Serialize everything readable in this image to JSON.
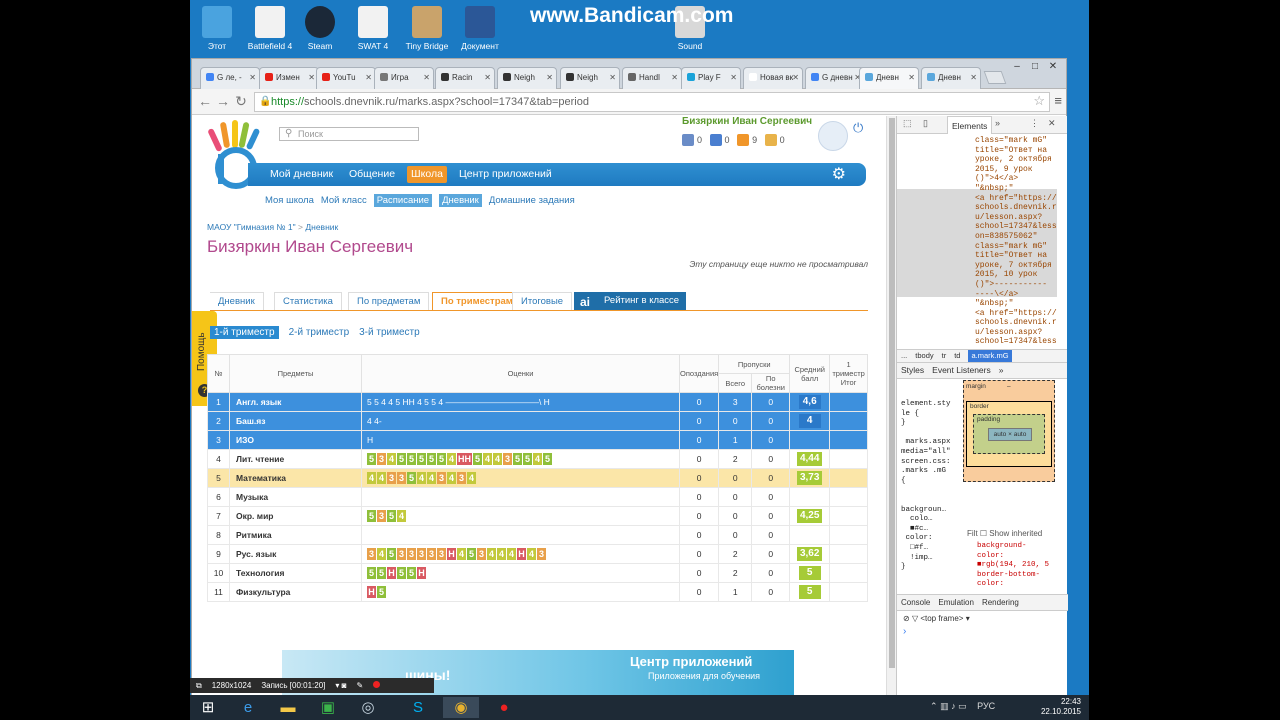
{
  "watermark": "www.Bandicam.com",
  "desktop_icons": [
    "Этот",
    "Battlefield 4",
    "Steam",
    "SWAT 4",
    "Tiny Bridge",
    "Документ",
    "Sound"
  ],
  "browser": {
    "tabs": [
      {
        "label": "G ле, -",
        "color": "#4285f4"
      },
      {
        "label": "Измен",
        "color": "#e62117"
      },
      {
        "label": "YouTu",
        "color": "#e62117"
      },
      {
        "label": "Игра",
        "color": "#777"
      },
      {
        "label": "Racin",
        "color": "#333"
      },
      {
        "label": "Neigh",
        "color": "#333"
      },
      {
        "label": "Neigh",
        "color": "#333"
      },
      {
        "label": "Handl",
        "color": "#666"
      },
      {
        "label": "Play F",
        "color": "#1aa3d9"
      },
      {
        "label": "Новая вк",
        "color": "#fff"
      },
      {
        "label": "G дневн",
        "color": "#4285f4"
      },
      {
        "label": "Дневн",
        "color": "#5aa7dc"
      },
      {
        "label": "Дневн",
        "color": "#5aa7dc"
      }
    ],
    "url_https": "https://",
    "url_rest": "schools.dnevnik.ru/marks.aspx?school=17347&tab=period"
  },
  "site": {
    "search_placeholder": "Поиск",
    "user_name": "Бизяркин Иван Сергеевич",
    "stats": [
      {
        "value": "0",
        "color": "#6a8cc7"
      },
      {
        "value": "0",
        "color": "#4a7fd0"
      },
      {
        "value": "9",
        "color": "#f0962a"
      },
      {
        "value": "0",
        "color": "#e8b34a"
      }
    ],
    "nav": [
      "Мой дневник",
      "Общение",
      "Школа",
      "Центр приложений"
    ],
    "subnav": [
      "Моя школа",
      "Мой класс",
      "Расписание",
      "Дневник",
      "Домашние задания"
    ],
    "breadcrumb_school": "МАОУ \"Гимназия № 1\"",
    "breadcrumb_sep": ">",
    "breadcrumb_page": "Дневник",
    "page_title": "Бизяркин Иван Сергеевич",
    "notice": "Эту страницу еще никто не просматривал",
    "help": "Помощь",
    "tabs": [
      "Дневник",
      "Статистика",
      "По предметам",
      "По триместрам",
      "Итоговые"
    ],
    "rating_label": "Рейтинг в классе",
    "terms": [
      "1-й триместр",
      "2-й триместр",
      "3-й триместр"
    ],
    "table_headers": {
      "num": "№",
      "subject": "Предметы",
      "marks": "Оценки",
      "late": "Опоздания",
      "absences": "Пропуски",
      "total": "Всего",
      "sick": "По болезни",
      "avg": "Средний балл",
      "final": "1 триместр Итог"
    },
    "rows": [
      {
        "n": "1",
        "subject": "Англ. язык",
        "marks": "5 5 4 4 5 НН 4 5 5 4 ———————————\\ Н",
        "late": "0",
        "total": "3",
        "sick": "0",
        "avg": "4,6",
        "state": "sel"
      },
      {
        "n": "2",
        "subject": "Баш.яз",
        "marks": "4 4-",
        "late": "0",
        "total": "0",
        "sick": "0",
        "avg": "4",
        "state": "sel"
      },
      {
        "n": "3",
        "subject": "ИЗО",
        "marks": "Н",
        "late": "0",
        "total": "1",
        "sick": "0",
        "avg": "",
        "state": "sel"
      },
      {
        "n": "4",
        "subject": "Лит. чтение",
        "marks": "5 3 4 5 5 5 5 5 4 НН 5 4 4 3 5 5 4 5",
        "late": "0",
        "total": "2",
        "sick": "0",
        "avg": "4,44",
        "state": ""
      },
      {
        "n": "5",
        "subject": "Математика",
        "marks": "4 4 3 3 5 4 4 3 4 3 4",
        "late": "0",
        "total": "0",
        "sick": "0",
        "avg": "3,73",
        "state": "hl"
      },
      {
        "n": "6",
        "subject": "Музыка",
        "marks": "",
        "late": "0",
        "total": "0",
        "sick": "0",
        "avg": "",
        "state": ""
      },
      {
        "n": "7",
        "subject": "Окр. мир",
        "marks": "5 3 5 4",
        "late": "0",
        "total": "0",
        "sick": "0",
        "avg": "4,25",
        "state": ""
      },
      {
        "n": "8",
        "subject": "Ритмика",
        "marks": "",
        "late": "0",
        "total": "0",
        "sick": "0",
        "avg": "",
        "state": ""
      },
      {
        "n": "9",
        "subject": "Рус. язык",
        "marks": "3 4 5 3 3 3 3 3 Н 4 5 3 4 4 4 Н 4 3",
        "late": "0",
        "total": "2",
        "sick": "0",
        "avg": "3,62",
        "state": ""
      },
      {
        "n": "10",
        "subject": "Технология",
        "marks": "5 5 Н 5 5 Н",
        "late": "0",
        "total": "2",
        "sick": "0",
        "avg": "5",
        "state": ""
      },
      {
        "n": "11",
        "subject": "Физкультура",
        "marks": "Н 5",
        "late": "0",
        "total": "1",
        "sick": "0",
        "avg": "5",
        "state": ""
      }
    ],
    "banner_left": "шины!",
    "banner_title": "Центр приложений",
    "banner_sub": "Приложения для обучения"
  },
  "devtools": {
    "elements_tab": "Elements",
    "dom_lines": [
      "class=\"mark mG\"",
      "title=\"Ответ на",
      "уроке, 2 октября",
      "2015, 9 урок",
      "()\">4</a>",
      "\"&nbsp;\"",
      "<a href=\"https://",
      "schools.dnevnik.r",
      "u/lesson.aspx?",
      "school=17347&less",
      "on=838575062\"",
      "class=\"mark mG\"",
      "title=\"Ответ на",
      "уроке, 7 октября",
      "2015, 10 урок",
      "()\">-----------",
      "----\\</a>",
      "\"&nbsp;\"",
      "<a href=\"https://",
      "schools.dnevnik.r",
      "u/lesson.aspx?",
      "school=17347&less"
    ],
    "crumbs": [
      "...",
      "tbody",
      "tr",
      "td",
      "a.mark.mG"
    ],
    "styles_tabs": [
      "Styles",
      "Event Listeners",
      "»"
    ],
    "styles_left": "element.sty\nle {\n}\n\n marks.aspx\nmedia=\"all\"\nscreen.css:\n.marks .mG\n{\n\n\nbackgroun…\n  colo…\n  ■#c…\n color:\n  □#f…\n  !imp…\n}",
    "styles_right": "background-\ncolor:\n■rgb(194, 210, 5\nborder-bottom-\ncolor:",
    "filter": "Filt",
    "show_inherited": "Show inherited",
    "box": {
      "margin": "margin",
      "border": "border",
      "padding": "padding",
      "content": "auto × auto",
      "dash": "–",
      "two": "2"
    },
    "console_tabs": [
      "Console",
      "Emulation",
      "Rendering"
    ],
    "frame": "<top frame>"
  },
  "bandicam_bar": {
    "resolution": "1280x1024",
    "record": "Запись [00:01:20]"
  },
  "tray": {
    "lang": "РУС",
    "time": "22:43",
    "date": "22.10.2015"
  }
}
